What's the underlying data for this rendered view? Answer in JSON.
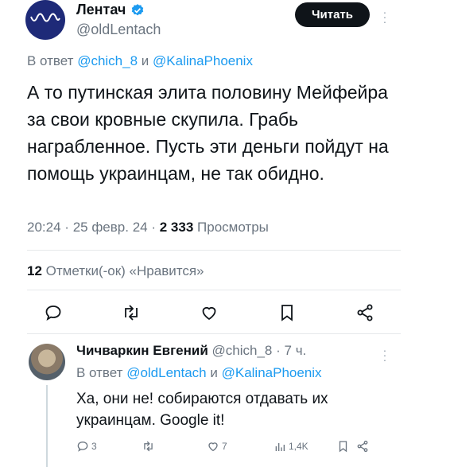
{
  "tweet": {
    "author_name": "Лентач",
    "author_handle": "@oldLentach",
    "follow_label": "Читать",
    "reply_prefix": "В ответ",
    "reply_to_1": "@chich_8",
    "reply_and": "и",
    "reply_to_2": "@KalinaPhoenix",
    "text": "А то путинская элита половину Мейфейра за свои кровные скупила. Грабь награбленное. Пусть эти деньги пойдут на помощь украинцам, не так обидно.",
    "time": "20:24",
    "sep": "·",
    "date": "25 февр. 24",
    "views_count": "2 333",
    "views_label": "Просмотры",
    "likes_count": "12",
    "likes_label": "Отметки(-ок) «Нравится»",
    "actions": [
      "reply-icon",
      "retweet-icon",
      "like-icon",
      "bookmark-icon",
      "share-icon"
    ]
  },
  "reply": {
    "author_name": "Чичваркин Евгений",
    "author_handle": "@chich_8",
    "sep": "·",
    "age": "7 ч.",
    "reply_prefix": "В ответ",
    "reply_to_1": "@oldLentach",
    "reply_and": "и",
    "reply_to_2": "@KalinaPhoenix",
    "text": "Ха, они не! собираются отдавать их украинцам. Google it!",
    "reply_count": "3",
    "like_count": "7",
    "view_count": "1,4K"
  },
  "colors": {
    "link": "#1d9bf0",
    "muted": "#6b7580",
    "text": "#0f1419",
    "avatar_bg": "#1e2a78"
  }
}
